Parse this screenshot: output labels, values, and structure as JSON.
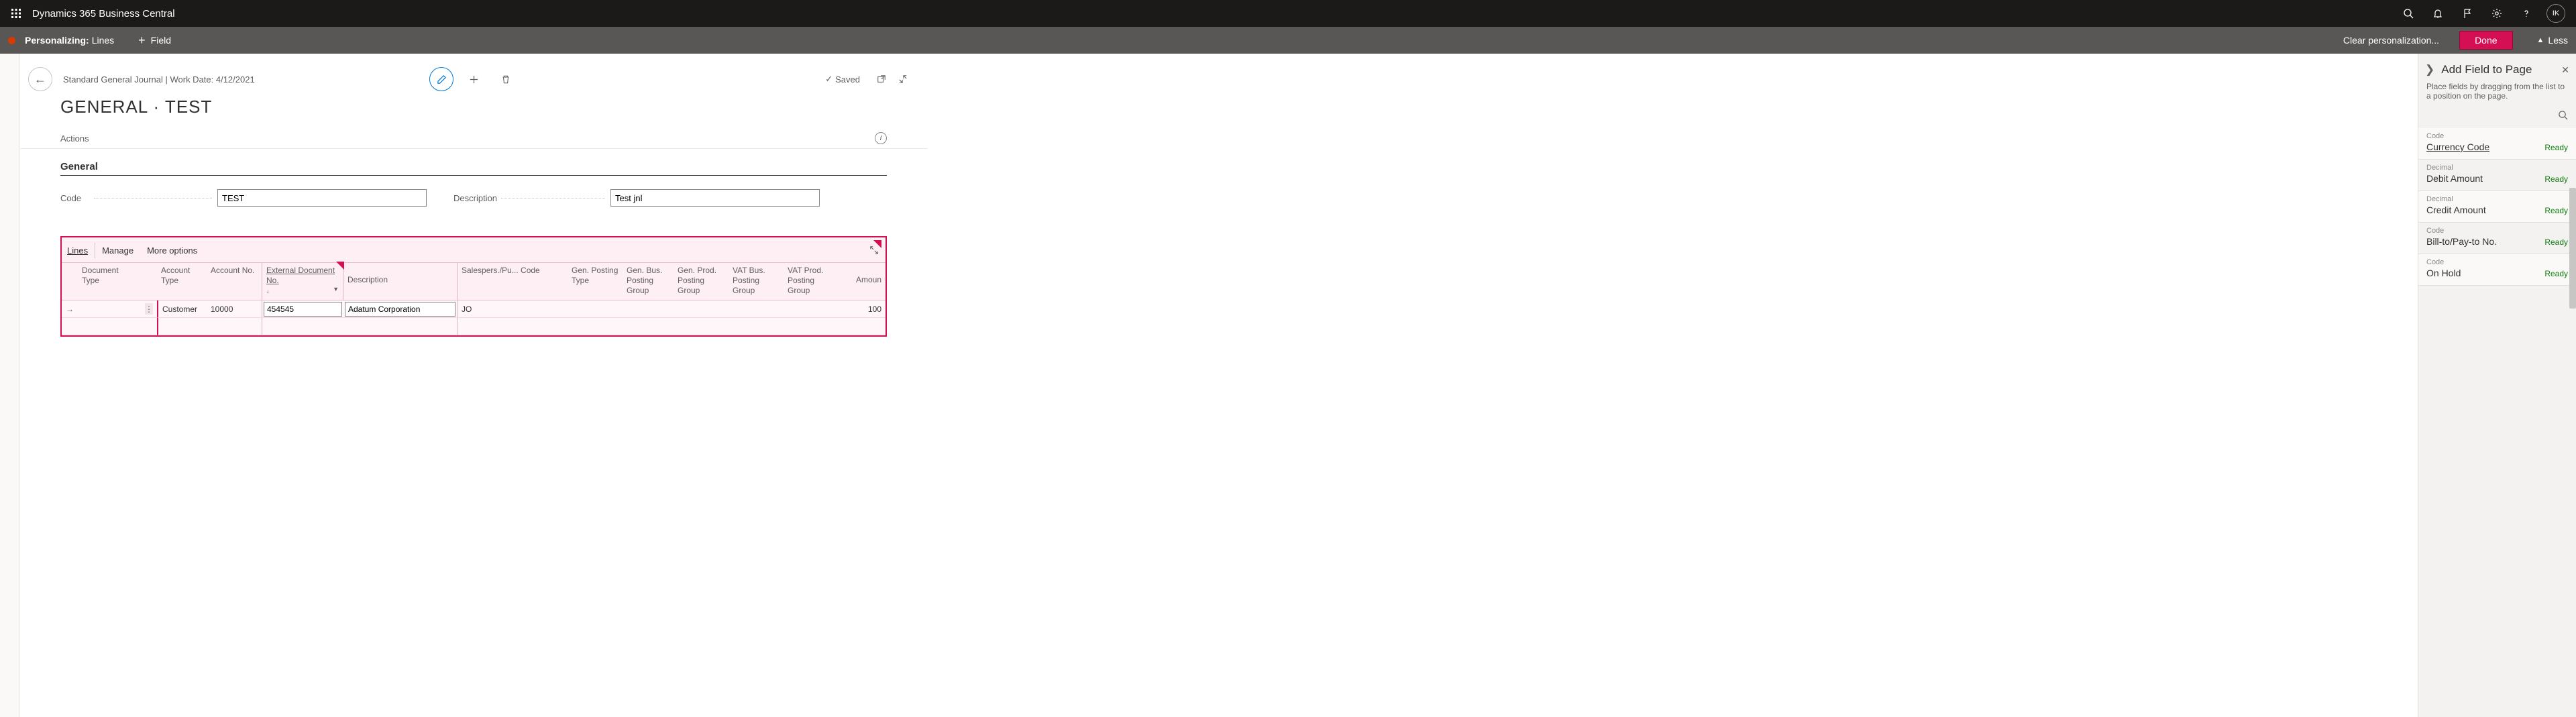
{
  "app": {
    "title": "Dynamics 365 Business Central",
    "avatar": "IK"
  },
  "pbar": {
    "label": "Personalizing:",
    "sublabel": "Lines",
    "addfield": "Field",
    "clear": "Clear personalization...",
    "done": "Done",
    "less": "Less"
  },
  "page": {
    "crumbs": "Standard General Journal | Work Date: 4/12/2021",
    "title": "GENERAL · TEST",
    "actions": "Actions",
    "saved": "Saved"
  },
  "general": {
    "heading": "General",
    "code_label": "Code",
    "code_value": "TEST",
    "desc_label": "Description",
    "desc_value": "Test jnl"
  },
  "lines": {
    "tab_lines": "Lines",
    "tab_manage": "Manage",
    "tab_more": "More options",
    "headers": {
      "doc_type": "Document Type",
      "acc_type": "Account Type",
      "acc_no": "Account No.",
      "ext_doc": "External Document No.",
      "description": "Description",
      "salesperson": "Salespers./Pu... Code",
      "gen_post_type": "Gen. Posting Type",
      "gen_bus": "Gen. Bus. Posting Group",
      "gen_prod": "Gen. Prod. Posting Group",
      "vat_bus": "VAT Bus. Posting Group",
      "vat_prod": "VAT Prod. Posting Group",
      "amount": "Amoun"
    },
    "row": {
      "acc_type": "Customer",
      "acc_no": "10000",
      "ext_doc": "454545",
      "description": "Adatum Corporation",
      "salesperson": "JO",
      "amount": "100"
    }
  },
  "rpane": {
    "title": "Add Field to Page",
    "desc": "Place fields by dragging from the list to a position on the page.",
    "items": [
      {
        "type": "Code",
        "name": "Currency Code",
        "state": "Ready",
        "link": true
      },
      {
        "type": "Decimal",
        "name": "Debit Amount",
        "state": "Ready",
        "link": false
      },
      {
        "type": "Decimal",
        "name": "Credit Amount",
        "state": "Ready",
        "link": false
      },
      {
        "type": "Code",
        "name": "Bill-to/Pay-to No.",
        "state": "Ready",
        "link": false
      },
      {
        "type": "Code",
        "name": "On Hold",
        "state": "Ready",
        "link": false
      }
    ]
  }
}
